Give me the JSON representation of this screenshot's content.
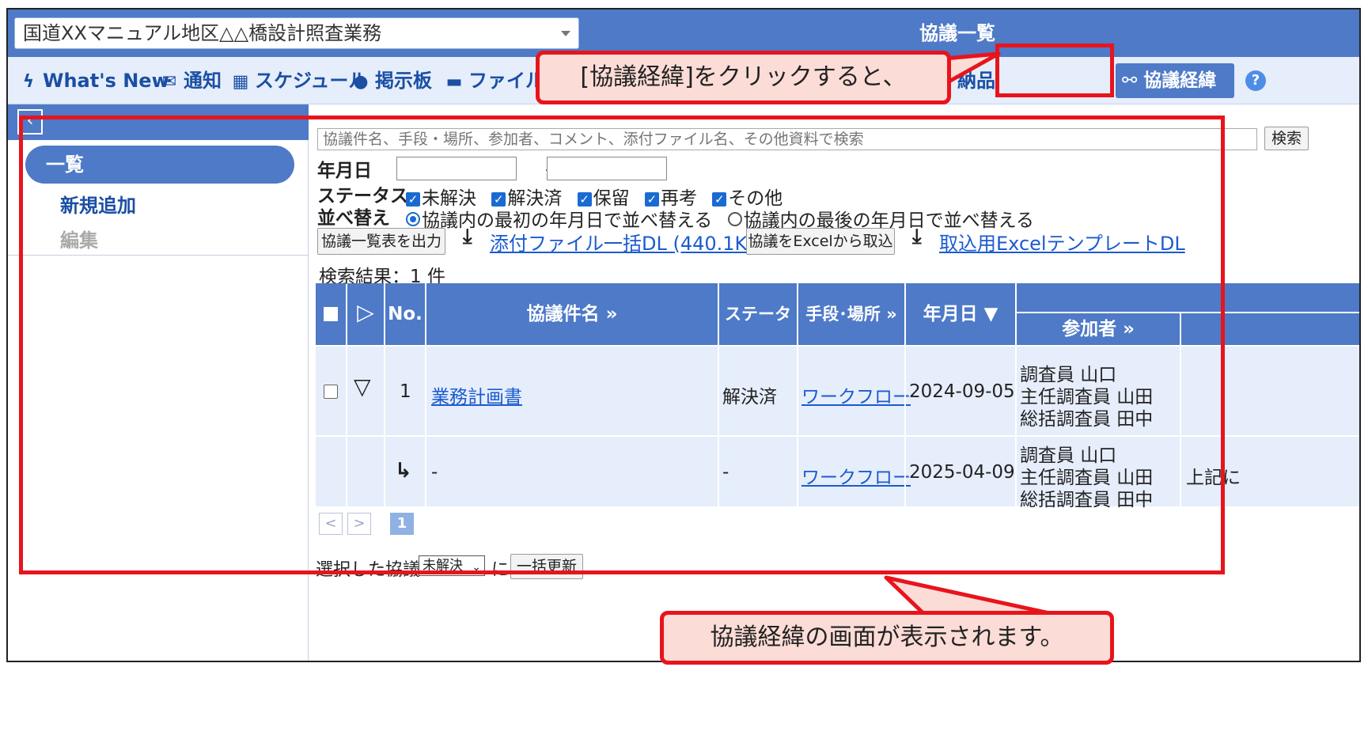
{
  "header": {
    "project": "国道XXマニュアル地区△△橋設計照査業務",
    "page_title": "協議一覧"
  },
  "nav": {
    "items": [
      {
        "icon": "lightning-icon",
        "label": "What's New"
      },
      {
        "icon": "envelope-icon",
        "label": "通知"
      },
      {
        "icon": "calendar-icon",
        "label": "スケジュール"
      },
      {
        "icon": "chat-icon",
        "label": "掲示板"
      },
      {
        "icon": "cabinet-icon",
        "label": "ファイルキ"
      },
      {
        "icon": "",
        "label": "納品"
      }
    ],
    "active": {
      "icon": "workflow-icon",
      "label": "協議経緯"
    },
    "help": "?"
  },
  "sidebar": {
    "items": [
      "一覧",
      "新規追加",
      "編集"
    ]
  },
  "search": {
    "placeholder": "協議件名、手段・場所、参加者、コメント、添付ファイル名、その他資料で検索",
    "button": "検索"
  },
  "filters": {
    "date_label": "年月日",
    "date_sep": "～",
    "status_label": "ステータス",
    "statuses": [
      "未解決",
      "解決済",
      "保留",
      "再考",
      "その他"
    ],
    "sort_label": "並べ替え",
    "sort_options": [
      "協議内の最初の年月日で並べ替える",
      "協議内の最後の年月日で並べ替える"
    ]
  },
  "actions": {
    "export_button": "協議一覧表を出力",
    "bulk_download": "添付ファイル一括DL (440.1KB)",
    "import_button": "協議をExcelから取込",
    "template_download": "取込用ExcelテンプレートDL"
  },
  "results": {
    "label": "検索結果：1 件"
  },
  "table": {
    "headers": {
      "no": "No.",
      "title": "協議件名 »",
      "status": "ステータス",
      "method": "手段･場所 »",
      "date": "年月日 ▼",
      "participants": "参加者 »"
    },
    "rows": [
      {
        "no": "1",
        "title": "業務計画書",
        "status": "解決済",
        "method": "ワークフロー",
        "date": "2024-09-05",
        "participants": [
          "調査員 山口",
          "主任調査員 山田",
          "総括調査員 田中"
        ],
        "extra": ""
      },
      {
        "no": "↳",
        "title": "-",
        "status": "-",
        "method": "ワークフロー",
        "date": "2025-04-09",
        "participants": [
          "調査員 山口",
          "主任調査員 山田",
          "総括調査員 田中"
        ],
        "extra": "上記に"
      }
    ]
  },
  "pagination": {
    "prev": "<",
    "next": ">",
    "current": "1"
  },
  "bulk": {
    "label": "選択した協議を",
    "selected": "未解決",
    "suffix": "に",
    "button": "一括更新"
  },
  "annotations": {
    "top": "[協議経緯]をクリックすると、",
    "bottom": "協議経緯の画面が表示されます。",
    "color": "#e8141c"
  }
}
